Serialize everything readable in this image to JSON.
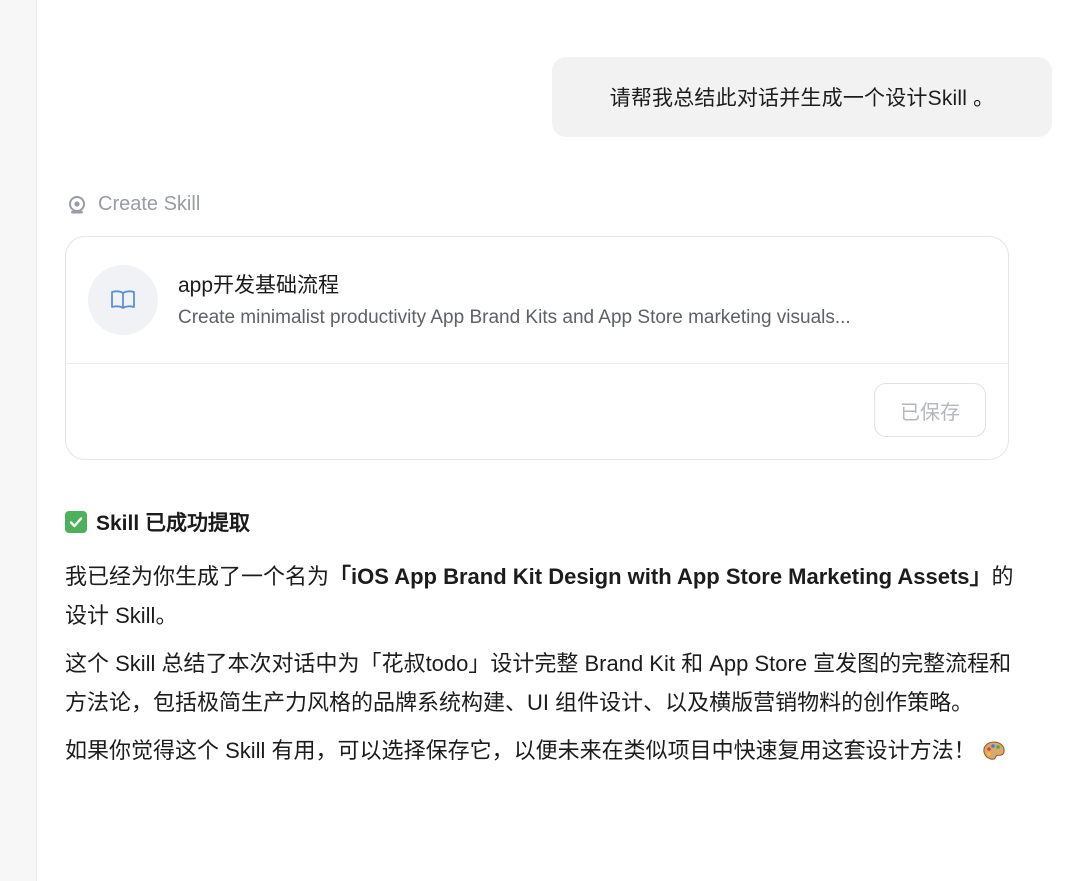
{
  "chat": {
    "user_message": "请帮我总结此对话并生成一个设计Skill 。"
  },
  "skill": {
    "header_label": "Create Skill",
    "icon": "skill-bot-icon",
    "card": {
      "icon": "book-icon",
      "title": "app开发基础流程",
      "description": "Create minimalist productivity App Brand Kits and App Store marketing visuals...",
      "saved_button": "已保存"
    }
  },
  "response": {
    "heading": "Skill 已成功提取",
    "heading_icon": "check-box-icon",
    "p1_prefix": "我已经为你生成了一个名为",
    "p1_name": "「iOS App Brand Kit Design with App Store Marketing Assets」",
    "p1_suffix": "的设计 Skill。",
    "p2": "这个 Skill 总结了本次对话中为「花叔todo」设计完整 Brand Kit 和 App Store 宣发图的完整流程和方法论，包括极简生产力风格的品牌系统构建、UI 组件设计、以及横版营销物料的创作策略。",
    "p3": "如果你觉得这个 Skill 有用，可以选择保存它，以便未来在类似项目中快速复用这套设计方法！",
    "p3_icon": "palette-icon"
  },
  "colors": {
    "bubble_bg": "#f2f2f3",
    "check_green": "#4cb15a",
    "book_blue": "#5b8fd9",
    "muted_text": "#9a9ca3"
  }
}
